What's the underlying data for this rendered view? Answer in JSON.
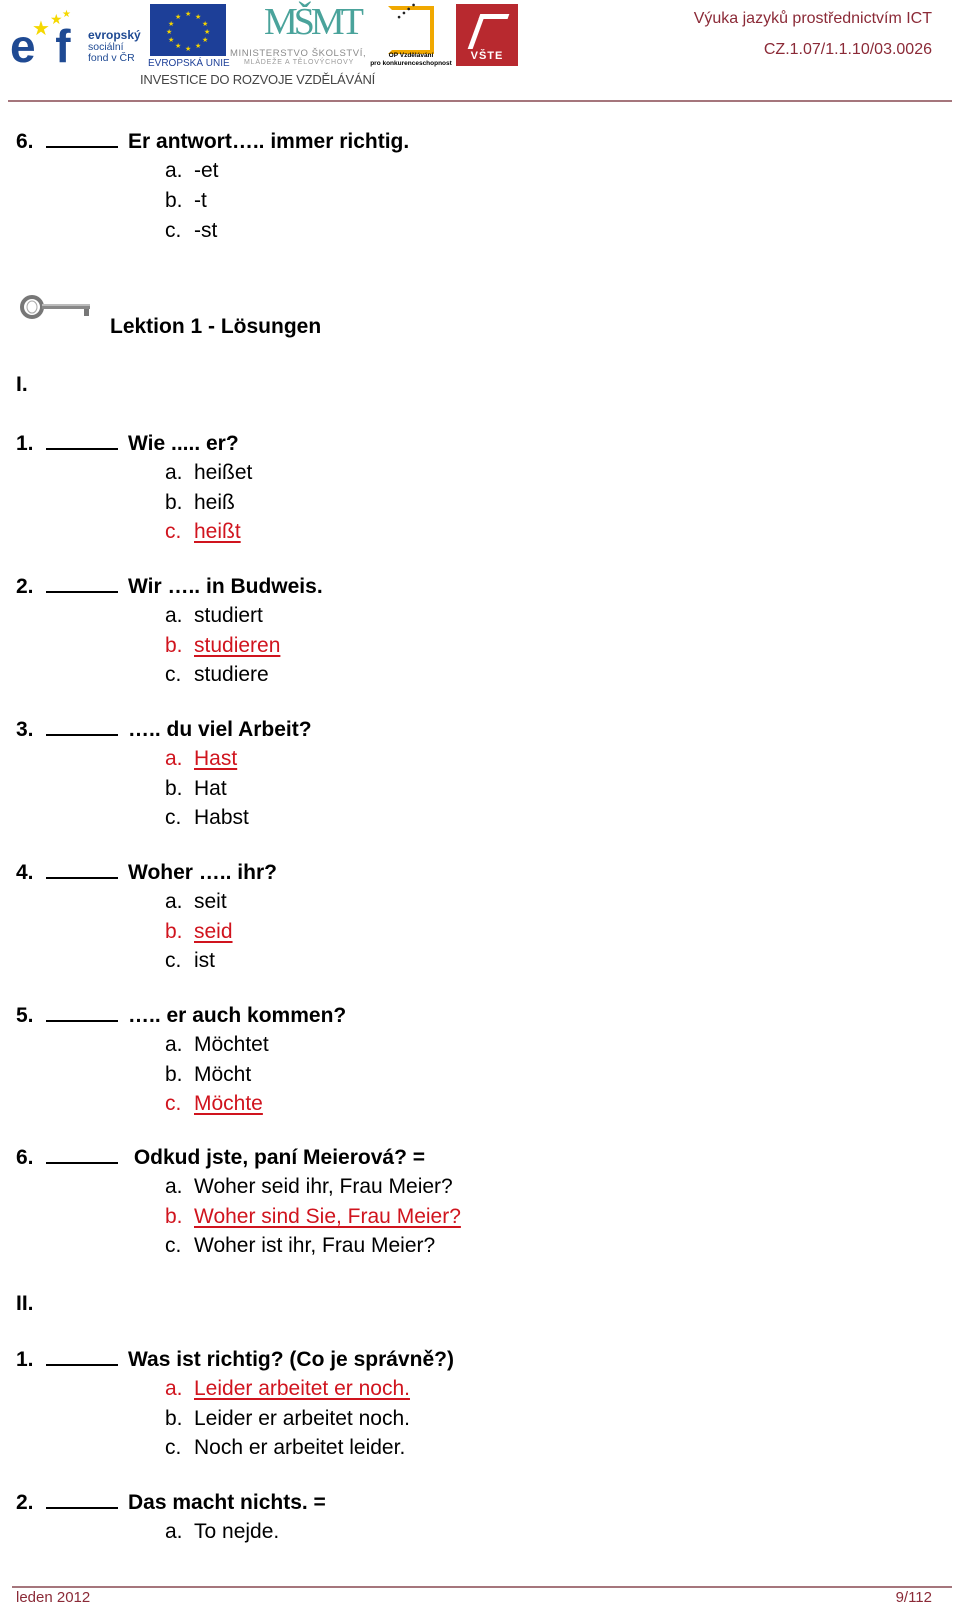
{
  "header": {
    "logos": {
      "esf": {
        "mark": "esf",
        "line1": "evropský",
        "line2": "sociální",
        "line3": "fond v ČR"
      },
      "eu": {
        "caption": "EVROPSKÁ UNIE"
      },
      "msmt": {
        "mark": "MŠMT",
        "line1": "MINISTERSTVO ŠKOLSTVÍ,",
        "line2": "MLÁDEŽE A TĚLOVÝCHOVY"
      },
      "op": {
        "line1": "OP Vzdělávání",
        "line2": "pro konkurenceschopnost"
      },
      "vste": {
        "caption": "VŠTE"
      }
    },
    "tagline": "INVESTICE DO ROZVOJE VZDĚLÁVÁNÍ",
    "project_title": "Výuka jazyků prostřednictvím ICT",
    "project_code": "CZ.1.07/1.1.10/03.0026"
  },
  "colors": {
    "accent": "#8b2a37",
    "correct": "#d0141e",
    "rule": "#a5767c"
  },
  "prev_question": {
    "number": "6.",
    "prompt": "Er antwort….. immer richtig.",
    "options": [
      {
        "letter": "a.",
        "text": "-et"
      },
      {
        "letter": "b.",
        "text": "-t"
      },
      {
        "letter": "c.",
        "text": "-st"
      }
    ]
  },
  "lesson": {
    "icon": "key-icon",
    "title": "Lektion 1 - Lösungen"
  },
  "sections": [
    {
      "label": "I.",
      "questions": [
        {
          "number": "1.",
          "prompt": "Wie .....  er?",
          "options": [
            {
              "letter": "a.",
              "text": "heißet",
              "correct": false
            },
            {
              "letter": "b.",
              "text": "heiß",
              "correct": false
            },
            {
              "letter": "c.",
              "text": "heißt",
              "correct": true
            }
          ]
        },
        {
          "number": "2.",
          "prompt": "Wir ….. in Budweis.",
          "options": [
            {
              "letter": "a.",
              "text": "studiert",
              "correct": false
            },
            {
              "letter": "b.",
              "text": "studieren",
              "correct": true
            },
            {
              "letter": "c.",
              "text": "studiere",
              "correct": false
            }
          ]
        },
        {
          "number": "3.",
          "prompt": "….. du viel Arbeit?",
          "options": [
            {
              "letter": "a.",
              "text": "Hast",
              "correct": true
            },
            {
              "letter": "b.",
              "text": "Hat",
              "correct": false
            },
            {
              "letter": "c.",
              "text": "Habst",
              "correct": false
            }
          ]
        },
        {
          "number": "4.",
          "prompt": "Woher ….. ihr?",
          "options": [
            {
              "letter": "a.",
              "text": "seit",
              "correct": false
            },
            {
              "letter": "b.",
              "text": "seid",
              "correct": true
            },
            {
              "letter": "c.",
              "text": "ist",
              "correct": false
            }
          ]
        },
        {
          "number": "5.",
          "prompt": "….. er auch kommen?",
          "options": [
            {
              "letter": "a.",
              "text": "Möchtet",
              "correct": false
            },
            {
              "letter": "b.",
              "text": "Möcht",
              "correct": false
            },
            {
              "letter": "c.",
              "text": "Möchte",
              "correct": true
            }
          ]
        },
        {
          "number": "6.",
          "prompt": " Odkud jste, paní Meierová?  =",
          "options": [
            {
              "letter": "a.",
              "text": "Woher seid ihr, Frau Meier?",
              "correct": false
            },
            {
              "letter": "b.",
              "text": "Woher sind Sie, Frau Meier?",
              "correct": true
            },
            {
              "letter": "c.",
              "text": "Woher ist ihr, Frau Meier?",
              "correct": false
            }
          ]
        }
      ]
    },
    {
      "label": "II.",
      "questions": [
        {
          "number": "1.",
          "prompt": "Was ist richtig? (Co je správně?)",
          "options": [
            {
              "letter": "a.",
              "text": "Leider arbeitet er noch.",
              "correct": true
            },
            {
              "letter": "b.",
              "text": "Leider er arbeitet noch.",
              "correct": false
            },
            {
              "letter": "c.",
              "text": "Noch er arbeitet leider.",
              "correct": false
            }
          ]
        },
        {
          "number": "2.",
          "prompt": "Das macht nichts. =",
          "options": [
            {
              "letter": "a.",
              "text": "To nejde.",
              "correct": false
            }
          ]
        }
      ]
    }
  ],
  "footer": {
    "date": "leden 2012",
    "page": "9/112"
  }
}
